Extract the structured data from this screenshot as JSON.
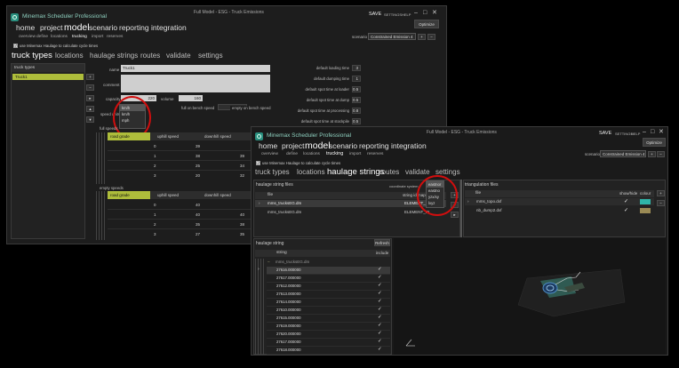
{
  "win1": {
    "title": "Minemax Scheduler Professional",
    "doc_title": "Full Model - ESG - Truck Emissions",
    "save": "SAVE",
    "settings": "SETTINGS",
    "help": "HELP",
    "optimize": "Optimize",
    "nav": [
      "home",
      "project",
      "model",
      "scenario",
      "reporting",
      "integration"
    ],
    "subnav": [
      "overview",
      "define",
      "locations",
      "trucking",
      "import",
      "reserves"
    ],
    "scenario_label": "scenario",
    "scenario_value": "Constrained Emission 4",
    "use_haulage": "use Minemax Haulage to calculate cycle times",
    "tabs": [
      "truck types",
      "locations",
      "haulage strings",
      "routes",
      "validate",
      "settings"
    ],
    "truck_types_header": "truck types",
    "truck_item": "Truck1",
    "name_label": "name",
    "name_value": "Truck1",
    "comment_label": "comment",
    "capacity_label": "capacity",
    "capacity_value": "220",
    "volume_label": "volume",
    "volume_value": "160",
    "speed_units_label": "speed units",
    "speed_units_value": "km/h",
    "speed_options": [
      "km/h",
      "mph"
    ],
    "full_bench_label": "full on bench speed",
    "full_bench_value": "20",
    "empty_bench_label": "empty on bench speed",
    "params": [
      {
        "label": "default loading time",
        "value": "3"
      },
      {
        "label": "default dumping time",
        "value": "1"
      },
      {
        "label": "default spot time at loader",
        "value": "0.5"
      },
      {
        "label": "default spot time at dump",
        "value": "0.5"
      },
      {
        "label": "default spot time at processing",
        "value": "0.8"
      },
      {
        "label": "default spot time at stockpile",
        "value": "0.5"
      }
    ],
    "full_speeds_label": "full speeds",
    "empty_speeds_label": "empty speeds",
    "speed_cols": [
      "road grade",
      "uphill speed",
      "downhill speed"
    ],
    "full_rows": [
      [
        "0",
        "39",
        ""
      ],
      [
        "1",
        "38",
        "39"
      ],
      [
        "2",
        "25",
        "34"
      ],
      [
        "3",
        "20",
        "32"
      ]
    ],
    "empty_rows": [
      [
        "0",
        "40",
        ""
      ],
      [
        "1",
        "40",
        "40"
      ],
      [
        "2",
        "35",
        "38"
      ],
      [
        "3",
        "27",
        "35"
      ]
    ]
  },
  "win2": {
    "title": "Minemax Scheduler Professional",
    "doc_title": "Full Model - ESG - Truck Emissions",
    "save": "SAVE",
    "settings": "SETTINGS",
    "help": "HELP",
    "optimize": "Optimize",
    "nav": [
      "home",
      "project",
      "model",
      "scenario",
      "reporting",
      "integration"
    ],
    "subnav": [
      "overview",
      "define",
      "locations",
      "trucking",
      "import",
      "reserves"
    ],
    "scenario_label": "scenario",
    "scenario_value": "Constrained Emission 4",
    "use_haulage": "use Minemax Haulage to calculate cycle times",
    "tabs": [
      "truck types",
      "locations",
      "haulage strings",
      "routes",
      "validate",
      "settings"
    ],
    "haulage_files_header": "haulage string files",
    "coord_label": "coordinate system",
    "file_col": "file",
    "string_col": "string id map",
    "files": [
      {
        "file": "mms_trucksEG.dm",
        "id": "ELEMENT_ID"
      },
      {
        "file": "mms_trucksEG.dm",
        "id": "ELEMENT_ID"
      }
    ],
    "coord_options": [
      "eastnor",
      "eastno",
      "yzx/xy",
      "lxyz"
    ],
    "tri_header": "triangulation files",
    "tri_cols": [
      "file",
      "show/hide",
      "colour"
    ],
    "tri_files": [
      {
        "file": "mms_topo.dxf",
        "color": "#2fb5a8"
      },
      {
        "file": "nb_dump2.dxf",
        "color": "#9a8a55"
      }
    ],
    "haulage_string_header": "haulage string",
    "refresh": "Refresh",
    "string_cols": [
      "string",
      "include"
    ],
    "group_label": "mms_trucksEG.dm",
    "strings": [
      "27616.000000",
      "27617.000000",
      "27612.000000",
      "27613.000000",
      "27614.000000",
      "27610.000000",
      "27615.000000",
      "27619.000000",
      "27620.000000",
      "27617.000000",
      "27618.000000"
    ]
  }
}
